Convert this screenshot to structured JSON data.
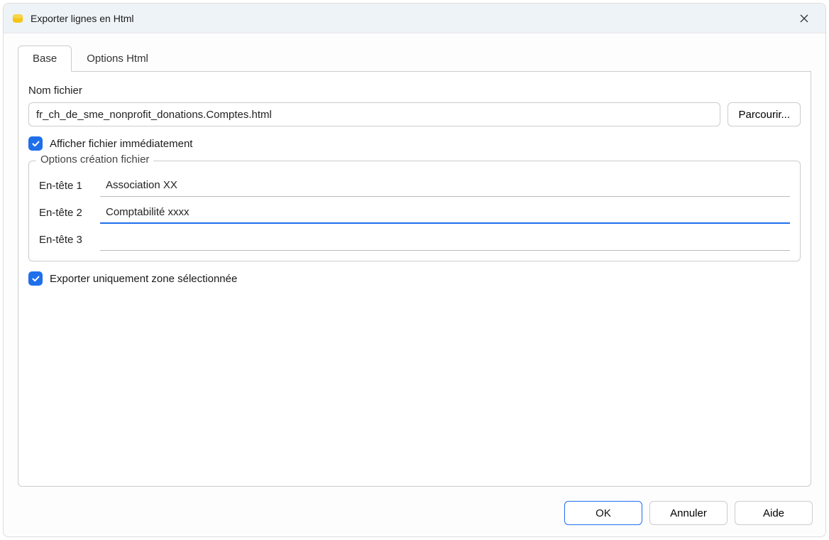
{
  "window": {
    "title": "Exporter lignes en Html"
  },
  "tabs": {
    "base": "Base",
    "options_html": "Options Html"
  },
  "form": {
    "filename_label": "Nom fichier",
    "filename_value": "fr_ch_de_sme_nonprofit_donations.Comptes.html",
    "browse_label": "Parcourir...",
    "show_file_label": "Afficher fichier immédiatement",
    "options_group_title": "Options création fichier",
    "header1_label": "En-tête 1",
    "header1_value": "Association XX",
    "header2_label": "En-tête 2",
    "header2_value": "Comptabilité xxxx",
    "header3_label": "En-tête 3",
    "header3_value": "",
    "export_selection_label": "Exporter uniquement zone sélectionnée"
  },
  "buttons": {
    "ok": "OK",
    "cancel": "Annuler",
    "help": "Aide"
  }
}
